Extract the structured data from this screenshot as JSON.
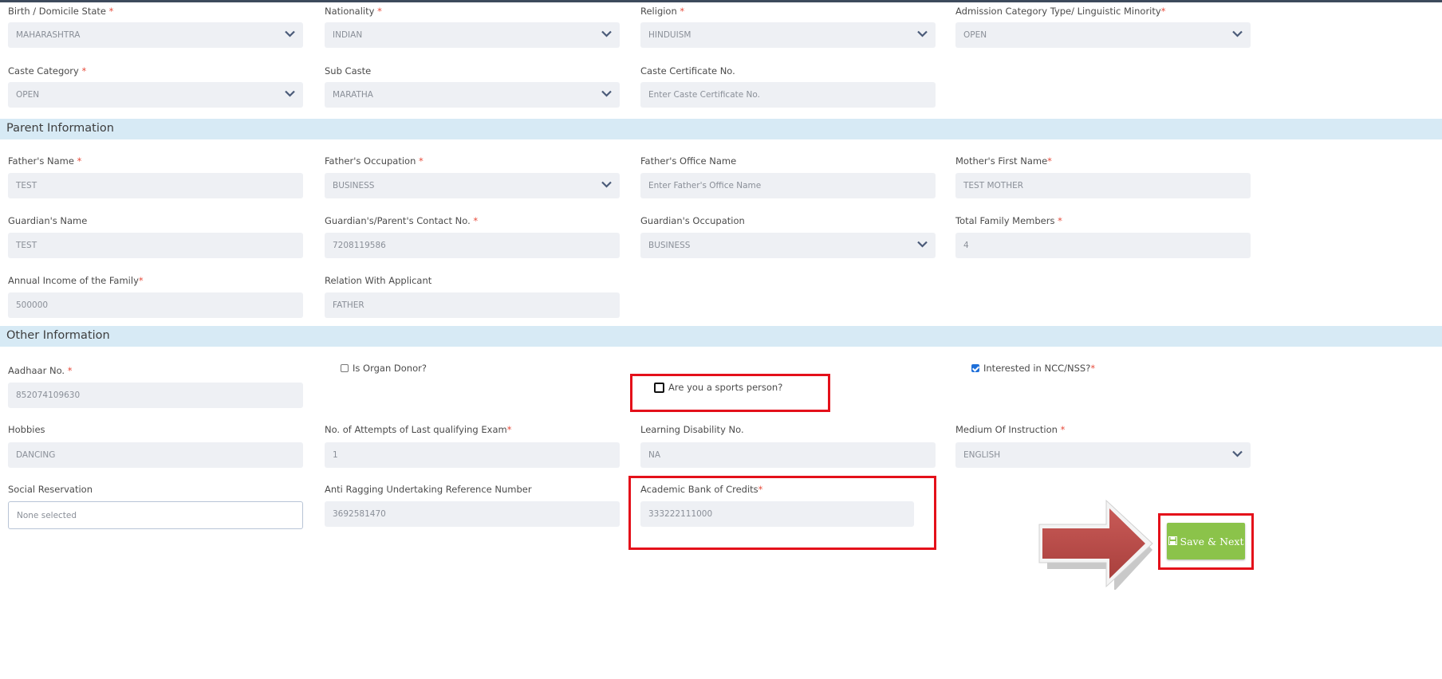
{
  "colors": {
    "section_bg": "#d7eaf5",
    "field_bg": "#eef0f4",
    "required": "#e74c3c",
    "highlight": "#e4101a",
    "save_bg": "#8bc34a",
    "arrow": "#c0504d"
  },
  "personal": {
    "birth_state": {
      "label": "Birth / Domicile State",
      "value": "MAHARASHTRA"
    },
    "nationality": {
      "label": "Nationality",
      "value": "INDIAN"
    },
    "religion": {
      "label": "Religion",
      "value": "HINDUISM"
    },
    "admission_category": {
      "label": "Admission Category Type/ Linguistic Minority",
      "value": "OPEN"
    },
    "caste_category": {
      "label": "Caste Category",
      "value": "OPEN"
    },
    "sub_caste": {
      "label": "Sub Caste",
      "value": "MARATHA"
    },
    "caste_cert": {
      "label": "Caste Certificate No.",
      "placeholder": "Enter Caste Certificate No."
    }
  },
  "parent": {
    "title": "Parent Information",
    "father_name": {
      "label": "Father's Name",
      "value": "TEST"
    },
    "father_occupation": {
      "label": "Father's Occupation",
      "value": "BUSINESS"
    },
    "father_office": {
      "label": "Father's Office Name",
      "placeholder": "Enter Father's Office Name"
    },
    "mother_name": {
      "label": "Mother's First Name",
      "value": "TEST MOTHER"
    },
    "guardian_name": {
      "label": "Guardian's Name",
      "value": "TEST"
    },
    "guardian_contact": {
      "label": "Guardian's/Parent's Contact No.",
      "value": "7208119586"
    },
    "guardian_occupation": {
      "label": "Guardian's Occupation",
      "value": "BUSINESS"
    },
    "family_members": {
      "label": "Total Family Members",
      "value": "4"
    },
    "annual_income": {
      "label": "Annual Income of the Family",
      "value": "500000"
    },
    "relation": {
      "label": "Relation With Applicant",
      "value": "FATHER"
    }
  },
  "other": {
    "title": "Other Information",
    "aadhaar": {
      "label": "Aadhaar No.",
      "value": "852074109630"
    },
    "organ_donor": {
      "label": "Is Organ Donor?",
      "checked": false
    },
    "sports_person": {
      "label": "Are you a sports person?",
      "checked": false
    },
    "ncc_nss": {
      "label": "Interested in NCC/NSS?",
      "checked": true
    },
    "hobbies": {
      "label": "Hobbies",
      "value": "DANCING"
    },
    "attempts": {
      "label": "No. of Attempts of Last qualifying Exam",
      "value": "1"
    },
    "learning_disability": {
      "label": "Learning Disability No.",
      "value": "NA"
    },
    "medium": {
      "label": "Medium Of Instruction",
      "value": "ENGLISH"
    },
    "social_reservation": {
      "label": "Social Reservation",
      "value": "None selected"
    },
    "anti_ragging": {
      "label": "Anti Ragging Undertaking Reference Number",
      "value": "3692581470"
    },
    "abc": {
      "label": "Academic Bank of Credits",
      "value": "333222111000"
    }
  },
  "save_button": {
    "label": "Save & Next",
    "icon": "floppy-disk-icon"
  },
  "arrow_icon": "right-arrow-icon",
  "required_mark": "*"
}
